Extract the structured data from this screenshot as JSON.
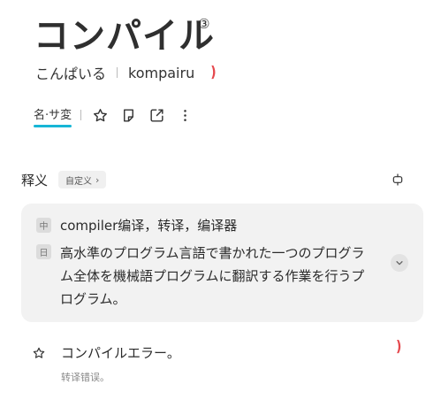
{
  "entry": {
    "headword": "コンパイル",
    "pitch_accent": "③",
    "kana_reading": "こんぱいる",
    "romaji": "kompairu",
    "speaker_glyph": ")"
  },
  "pos": {
    "tag": "名·サ変"
  },
  "definitions": {
    "title": "释义",
    "custom_label": "自定义",
    "chevron": "›",
    "zh_badge": "中",
    "zh_text": "compiler编译，转译，编译器",
    "ja_badge": "日",
    "ja_text": "高水準のプログラム言語で書かれた一つのプログラム全体を機械語プログラムに翻訳する作業を行うプログラム。"
  },
  "example": {
    "ja": "コンパイルエラー。",
    "zh": "转译错误。",
    "speaker_glyph": ")"
  },
  "colors": {
    "accent_underline": "#17b6d6",
    "speaker_red": "#e5484d",
    "card_bg": "#f2f2f2"
  }
}
